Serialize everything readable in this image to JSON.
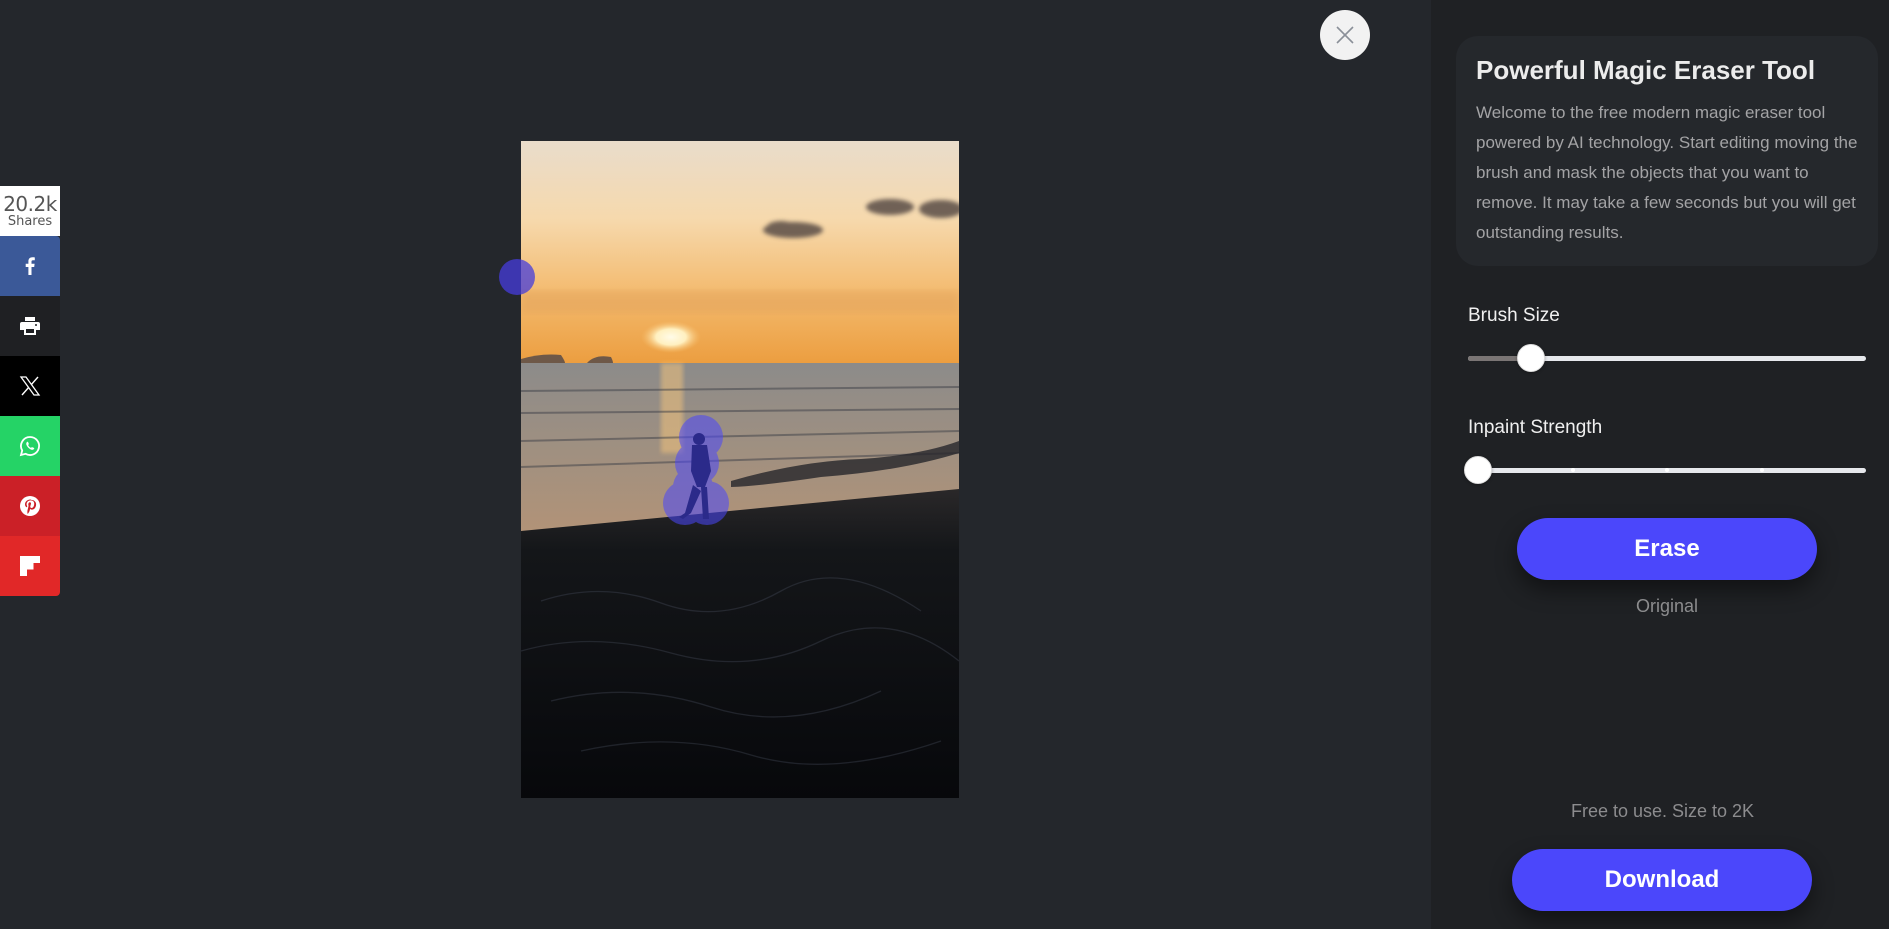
{
  "workspace": {
    "close_icon": "close-icon",
    "image": {
      "description": "Beach at sunset with a walking person",
      "mask_color": "#4b47fb"
    },
    "brush_cursor": "brush-cursor"
  },
  "share": {
    "count": "20.2k",
    "count_label": "Shares",
    "buttons": [
      {
        "network": "facebook",
        "icon": "facebook-icon",
        "color": "#3b5998"
      },
      {
        "network": "print",
        "icon": "printer-icon",
        "color": "#1f2023"
      },
      {
        "network": "x",
        "icon": "x-icon",
        "color": "#000000"
      },
      {
        "network": "whatsapp",
        "icon": "whatsapp-icon",
        "color": "#25d366"
      },
      {
        "network": "pinterest",
        "icon": "pinterest-icon",
        "color": "#cb2027"
      },
      {
        "network": "flipboard",
        "icon": "flipboard-icon",
        "color": "#e12828"
      }
    ]
  },
  "panel": {
    "title": "Powerful Magic Eraser Tool",
    "description": "Welcome to the free modern magic eraser tool powered by AI technology. Start editing moving the brush and mask the objects that you want to remove. It may take a few seconds but you will get outstanding results.",
    "brush_size": {
      "label": "Brush Size",
      "value_fraction": 0.14
    },
    "inpaint_strength": {
      "label": "Inpaint Strength",
      "value_fraction": 0.0,
      "steps": 4
    },
    "erase_label": "Erase",
    "original_label": "Original",
    "free_note": "Free to use. Size to 2K",
    "download_label": "Download",
    "accent_color": "#4b47fb"
  }
}
